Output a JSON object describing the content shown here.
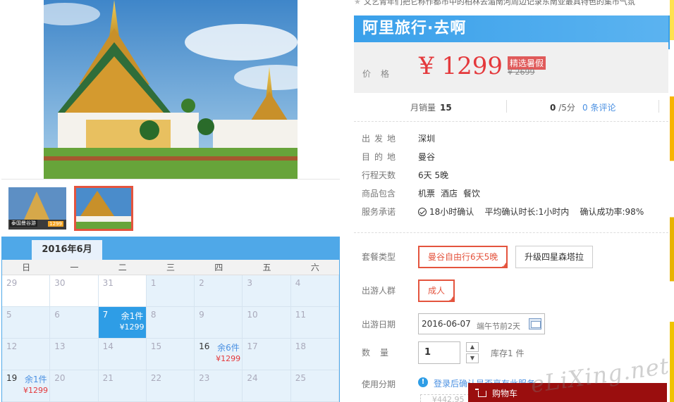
{
  "top_description": "文艺青年们把它称作都市中的柏林去湄南河周边记录东南亚最具特色的集市气氛",
  "brand": "阿里旅行·去啊",
  "price": {
    "label": "价格",
    "value": "¥ 1299",
    "badge": "精选暑假",
    "original": "¥ 2699"
  },
  "stats": {
    "monthly_sales_label": "月销量",
    "monthly_sales_value": "15",
    "rating_value": "0",
    "rating_suffix": "/5分",
    "reviews": "0 条评论"
  },
  "info": {
    "departure_label": "出发地",
    "departure": "深圳",
    "destination_label": "目的地",
    "destination": "曼谷",
    "duration_label": "行程天数",
    "duration": "6天 5晚",
    "includes_label": "商品包含",
    "includes": [
      "机票",
      "酒店",
      "餐饮"
    ],
    "service_label": "服务承诺",
    "service_1": "18小时确认",
    "service_2": "平均确认时长:1小时内",
    "service_3": "确认成功率:98%"
  },
  "options": {
    "package_label": "套餐类型",
    "package_1": "曼谷自由行6天5晚",
    "package_2": "升级四星森塔拉",
    "traveler_label": "出游人群",
    "traveler_1": "成人",
    "date_label": "出游日期",
    "date_value": "2016-06-07",
    "date_hint": "端午节前2天",
    "qty_label": "数量",
    "qty_value": "1",
    "stock": "库存1 件",
    "install_label": "使用分期",
    "install_text": "登录后确认是否享有此服务",
    "install_price": "¥442.95",
    "cart": "购物车"
  },
  "thumbnails": {
    "t1_caption": "泰国曼谷游",
    "t1_price": "1299"
  },
  "calendar": {
    "month": "2016年6月",
    "weekdays": [
      "日",
      "一",
      "二",
      "三",
      "四",
      "五",
      "六"
    ],
    "rows": [
      [
        {
          "d": "29"
        },
        {
          "d": "30"
        },
        {
          "d": "31"
        },
        {
          "d": "1"
        },
        {
          "d": "2"
        },
        {
          "d": "3"
        },
        {
          "d": "4"
        }
      ],
      [
        {
          "d": "5"
        },
        {
          "d": "6"
        },
        {
          "d": "7",
          "stock": "余1件",
          "price": "¥1299",
          "selected": true
        },
        {
          "d": "8"
        },
        {
          "d": "9"
        },
        {
          "d": "10"
        },
        {
          "d": "11"
        }
      ],
      [
        {
          "d": "12"
        },
        {
          "d": "13"
        },
        {
          "d": "14"
        },
        {
          "d": "15"
        },
        {
          "d": "16",
          "stock": "余6件",
          "price": "¥1299"
        },
        {
          "d": "17"
        },
        {
          "d": "18"
        }
      ],
      [
        {
          "d": "19",
          "stock": "余1件",
          "price": "¥1299"
        },
        {
          "d": "20"
        },
        {
          "d": "21"
        },
        {
          "d": "22"
        },
        {
          "d": "23"
        },
        {
          "d": "24"
        },
        {
          "d": "25"
        }
      ]
    ]
  },
  "watermark": "eLiXing.net",
  "colors": {
    "brand_blue": "#3aa0ea",
    "price_red": "#e4393c",
    "accent_orange": "#e4543e",
    "cart_red": "#9a0e0e"
  }
}
